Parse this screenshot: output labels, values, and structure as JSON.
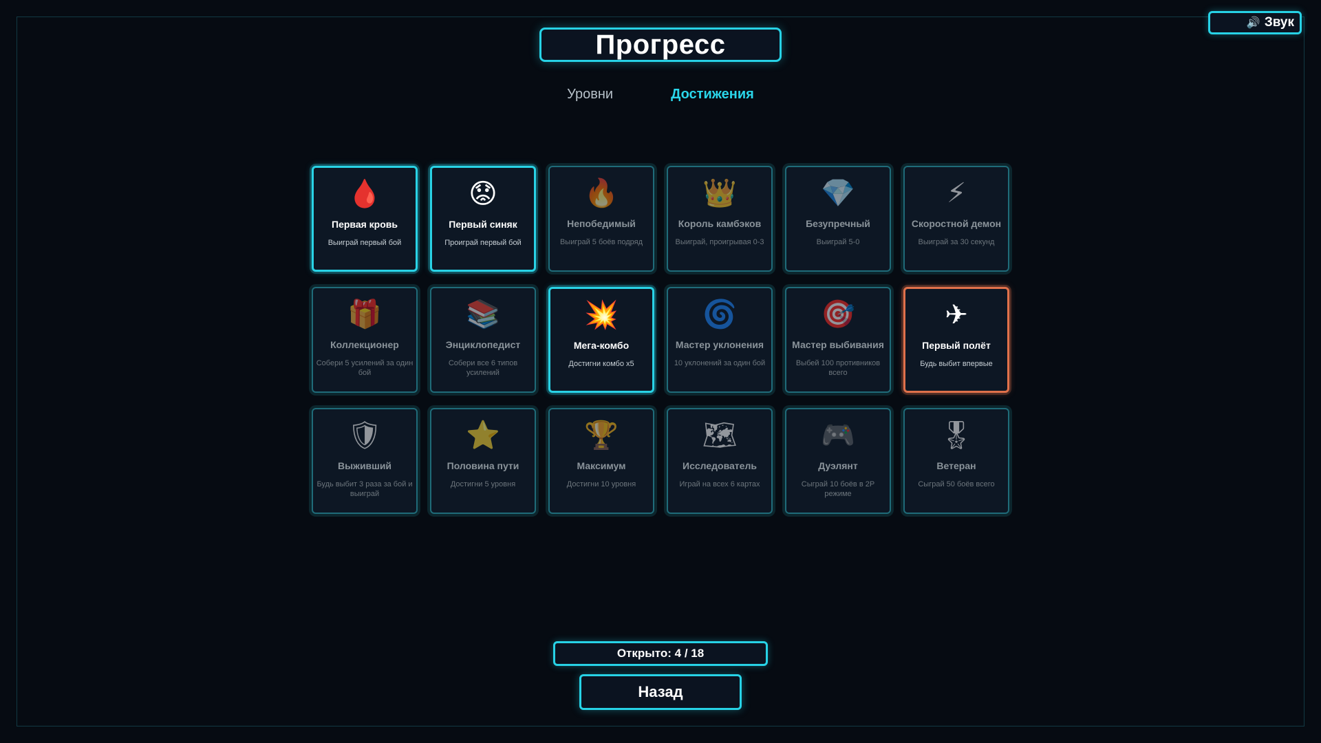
{
  "sound_button": {
    "icon": "speaker-icon",
    "icon_glyph": "🔊",
    "label": "Звук"
  },
  "title": "Прогресс",
  "tabs": [
    {
      "label": "Уровни",
      "active": false
    },
    {
      "label": "Достижения",
      "active": true
    }
  ],
  "achievements": [
    {
      "icon": "blood-drop-icon",
      "glyph": "🩸",
      "name": "Первая кровь",
      "desc": "Выиграй первый бой",
      "state": "unlocked"
    },
    {
      "icon": "sad-face-icon",
      "glyph": "😟",
      "name": "Первый синяк",
      "desc": "Проиграй первый бой",
      "state": "unlocked"
    },
    {
      "icon": "fire-icon",
      "glyph": "🔥",
      "name": "Непобедимый",
      "desc": "Выиграй 5 боёв подряд",
      "state": "locked"
    },
    {
      "icon": "crown-icon",
      "glyph": "👑",
      "name": "Король камбэков",
      "desc": "Выиграй, проигрывая 0-3",
      "state": "locked"
    },
    {
      "icon": "diamond-icon",
      "glyph": "💎",
      "name": "Безупречный",
      "desc": "Выиграй 5-0",
      "state": "locked"
    },
    {
      "icon": "lightning-icon",
      "glyph": "⚡",
      "name": "Скоростной демон",
      "desc": "Выиграй за 30 секунд",
      "state": "locked"
    },
    {
      "icon": "gift-icon",
      "glyph": "🎁",
      "name": "Коллекционер",
      "desc": "Собери 5 усилений за один бой",
      "state": "locked"
    },
    {
      "icon": "books-icon",
      "glyph": "📚",
      "name": "Энциклопедист",
      "desc": "Собери все 6 типов усилений",
      "state": "locked"
    },
    {
      "icon": "explosion-icon",
      "glyph": "💥",
      "name": "Мега-комбо",
      "desc": "Достигни комбо x5",
      "state": "unlocked"
    },
    {
      "icon": "swirl-icon",
      "glyph": "🌀",
      "name": "Мастер уклонения",
      "desc": "10 уклонений за один бой",
      "state": "locked"
    },
    {
      "icon": "target-icon",
      "glyph": "🎯",
      "name": "Мастер выбивания",
      "desc": "Выбей 100 противников всего",
      "state": "locked"
    },
    {
      "icon": "airplane-icon",
      "glyph": "✈",
      "name": "Первый полёт",
      "desc": "Будь выбит впервые",
      "state": "special"
    },
    {
      "icon": "shield-icon",
      "glyph": "🛡",
      "name": "Выживший",
      "desc": "Будь выбит 3 раза за бой и выиграй",
      "state": "locked"
    },
    {
      "icon": "star-icon",
      "glyph": "⭐",
      "name": "Половина пути",
      "desc": "Достигни 5 уровня",
      "state": "locked"
    },
    {
      "icon": "trophy-icon",
      "glyph": "🏆",
      "name": "Максимум",
      "desc": "Достигни 10 уровня",
      "state": "locked"
    },
    {
      "icon": "map-icon",
      "glyph": "🗺",
      "name": "Исследователь",
      "desc": "Играй на всех 6 картах",
      "state": "locked"
    },
    {
      "icon": "gamepad-icon",
      "glyph": "🎮",
      "name": "Дуэлянт",
      "desc": "Сыграй 10 боёв в 2P режиме",
      "state": "locked"
    },
    {
      "icon": "medal-icon",
      "glyph": "🎖",
      "name": "Ветеран",
      "desc": "Сыграй 50 боёв всего",
      "state": "locked"
    }
  ],
  "counter": {
    "label": "Открыто: 4 / 18",
    "unlocked": 4,
    "total": 18
  },
  "back_button": {
    "label": "Назад"
  },
  "colors": {
    "accent": "#27d2e6",
    "special": "#e0714b",
    "background": "#060b12",
    "card": "#0d1724"
  }
}
